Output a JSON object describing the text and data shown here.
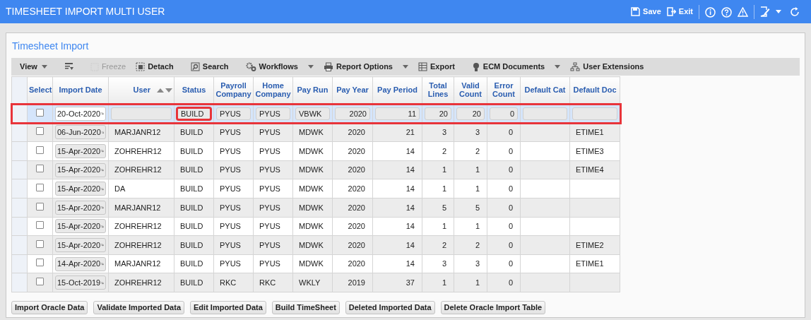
{
  "window": {
    "title": "TIMESHEET IMPORT MULTI USER"
  },
  "header_actions": [
    {
      "label": "Save"
    },
    {
      "label": "Exit"
    }
  ],
  "panel": {
    "title": "Timesheet Import"
  },
  "toolbar": [
    {
      "label": "View",
      "disabled": false,
      "dropdown": true
    },
    {
      "disabled": false,
      "dropdown": false
    },
    {
      "label": "Freeze",
      "disabled": true,
      "dropdown": false
    },
    {
      "label": "Detach",
      "disabled": false,
      "dropdown": false
    },
    {
      "label": "Search",
      "disabled": false,
      "dropdown": false
    },
    {
      "label": "Workflows",
      "disabled": false,
      "dropdown": true
    },
    {
      "label": "Report Options",
      "disabled": false,
      "dropdown": true
    },
    {
      "label": "Export",
      "disabled": false,
      "dropdown": false
    },
    {
      "label": "ECM Documents",
      "disabled": false,
      "dropdown": true
    },
    {
      "label": "User Extensions",
      "disabled": false,
      "dropdown": false
    }
  ],
  "table": {
    "columns": [
      "Select",
      "Import Date",
      "User",
      "Status",
      "Payroll Company",
      "Home Company",
      "Pay Run",
      "Pay Year",
      "Pay Period",
      "Total Lines",
      "Valid Count",
      "Error Count",
      "Default Cat",
      "Default Doc"
    ],
    "rows": [
      {
        "kind": "edit",
        "selected": true,
        "checked": false,
        "highlighted": true,
        "status_highlighted": true,
        "cells": [
          "",
          "20-Oct-2020",
          "",
          "BUILD",
          "PYUS",
          "PYUS",
          "VBWK",
          "2020",
          "11",
          "20",
          "20",
          "0",
          "",
          ""
        ]
      },
      {
        "kind": "view",
        "selected": false,
        "checked": false,
        "highlighted": false,
        "status_highlighted": false,
        "cells": [
          "",
          "06-Jun-2020",
          "MARJANR12",
          "BUILD",
          "PYUS",
          "PYUS",
          "MDWK",
          "2020",
          "21",
          "3",
          "3",
          "0",
          "",
          "ETIME1"
        ]
      },
      {
        "kind": "view",
        "selected": false,
        "checked": false,
        "highlighted": false,
        "status_highlighted": false,
        "cells": [
          "",
          "15-Apr-2020",
          "ZOHREHR12",
          "BUILD",
          "PYUS",
          "PYUS",
          "MDWK",
          "2020",
          "14",
          "2",
          "2",
          "0",
          "",
          "ETIME3"
        ]
      },
      {
        "kind": "view",
        "selected": false,
        "checked": false,
        "highlighted": false,
        "status_highlighted": false,
        "cells": [
          "",
          "15-Apr-2020",
          "ZOHREHR12",
          "BUILD",
          "PYUS",
          "PYUS",
          "MDWK",
          "2020",
          "14",
          "1",
          "1",
          "0",
          "",
          "ETIME4"
        ]
      },
      {
        "kind": "view",
        "selected": false,
        "checked": false,
        "highlighted": false,
        "status_highlighted": false,
        "cells": [
          "",
          "15-Apr-2020",
          "DA",
          "BUILD",
          "PYUS",
          "PYUS",
          "MDWK",
          "2020",
          "14",
          "1",
          "1",
          "0",
          "",
          ""
        ]
      },
      {
        "kind": "view",
        "selected": false,
        "checked": false,
        "highlighted": false,
        "status_highlighted": false,
        "cells": [
          "",
          "15-Apr-2020",
          "MARJANR12",
          "BUILD",
          "PYUS",
          "PYUS",
          "MDWK",
          "2020",
          "14",
          "5",
          "5",
          "0",
          "",
          ""
        ]
      },
      {
        "kind": "view",
        "selected": false,
        "checked": false,
        "highlighted": false,
        "status_highlighted": false,
        "cells": [
          "",
          "15-Apr-2020",
          "ZOHREHR12",
          "BUILD",
          "PYUS",
          "PYUS",
          "MDWK",
          "2020",
          "14",
          "1",
          "1",
          "0",
          "",
          ""
        ]
      },
      {
        "kind": "view",
        "selected": false,
        "checked": false,
        "highlighted": false,
        "status_highlighted": false,
        "cells": [
          "",
          "15-Apr-2020",
          "ZOHREHR12",
          "BUILD",
          "PYUS",
          "PYUS",
          "MDWK",
          "2020",
          "14",
          "2",
          "2",
          "0",
          "",
          "ETIME2"
        ]
      },
      {
        "kind": "view",
        "selected": false,
        "checked": false,
        "highlighted": false,
        "status_highlighted": false,
        "cells": [
          "",
          "14-Apr-2020",
          "MARJANR12",
          "BUILD",
          "PYUS",
          "PYUS",
          "MDWK",
          "2020",
          "14",
          "3",
          "3",
          "0",
          "",
          "ETIME1"
        ]
      },
      {
        "kind": "view",
        "selected": false,
        "checked": false,
        "highlighted": false,
        "status_highlighted": false,
        "cells": [
          "",
          "15-Oct-2019",
          "ZOHREHR12",
          "BUILD",
          "RKC",
          "RKC",
          "WKLY",
          "2019",
          "37",
          "1",
          "1",
          "0",
          "",
          ""
        ]
      }
    ]
  },
  "buttons": [
    "Import Oracle Data",
    "Validate Imported Data",
    "Edit Imported Data",
    "Build TimeSheet",
    "Deleted Imported Data",
    "Delete Oracle Import Table"
  ]
}
